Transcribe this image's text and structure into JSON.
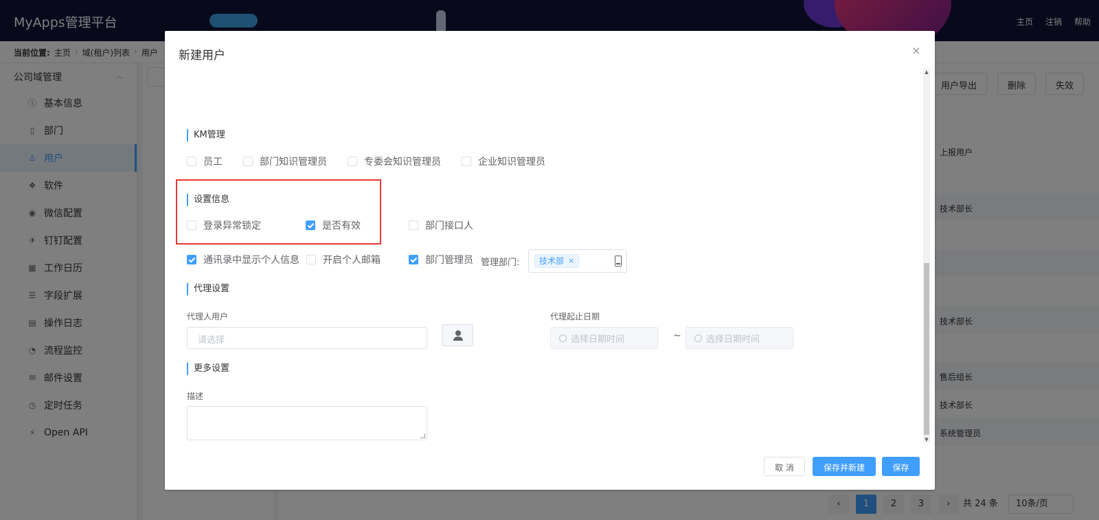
{
  "app": {
    "title": "MyApps管理平台"
  },
  "header": {
    "nav": [
      "主页",
      "注销",
      "帮助"
    ]
  },
  "breadcrumb": {
    "label": "当前位置:",
    "items": [
      "主页",
      "域(租户)列表",
      "用户"
    ]
  },
  "sidebar": {
    "group": "公司域管理",
    "items": [
      {
        "label": "基本信息",
        "icon": "info-icon"
      },
      {
        "label": "部门",
        "icon": "building-icon"
      },
      {
        "label": "用户",
        "icon": "user-icon",
        "active": true
      },
      {
        "label": "软件",
        "icon": "cubes-icon"
      },
      {
        "label": "微信配置",
        "icon": "wechat-icon"
      },
      {
        "label": "钉钉配置",
        "icon": "plane-icon"
      },
      {
        "label": "工作日历",
        "icon": "calendar-icon"
      },
      {
        "label": "字段扩展",
        "icon": "sliders-icon"
      },
      {
        "label": "操作日志",
        "icon": "log-icon"
      },
      {
        "label": "流程监控",
        "icon": "dashboard-icon"
      },
      {
        "label": "邮件设置",
        "icon": "mail-icon"
      },
      {
        "label": "定时任务",
        "icon": "clock-icon"
      },
      {
        "label": "Open API",
        "icon": "plug-icon"
      }
    ]
  },
  "background": {
    "buttons": [
      "用户导出",
      "删除",
      "失效"
    ],
    "column_header": "上报用户",
    "cells": [
      "技术部长",
      "技术部长",
      "售后组长",
      "技术部长",
      "系统管理员"
    ],
    "pager": {
      "pages": [
        "1",
        "2",
        "3"
      ],
      "total": "共 24 条",
      "page_size": "10条/页"
    }
  },
  "dialog": {
    "title": "新建用户",
    "km": {
      "title": "KM管理",
      "options": [
        "员工",
        "部门知识管理员",
        "专委会知识管理员",
        "企业知识管理员"
      ]
    },
    "settings": {
      "title": "设置信息",
      "lock_label": "登录异常锁定",
      "valid_label": "是否有效",
      "dept_contact_label": "部门接口人",
      "show_info_label": "通讯录中显示个人信息",
      "email_label": "开启个人邮箱",
      "dept_admin_label": "部门管理员",
      "manage_dept_label": "管理部门:",
      "manage_dept_tag": "技术部",
      "tag_close": "×"
    },
    "proxy": {
      "title": "代理设置",
      "user_label": "代理人用户",
      "user_placeholder": "请选择",
      "date_label": "代理起止日期",
      "start_placeholder": "选择日期时间",
      "end_placeholder": "选择日期时间",
      "separator": "~"
    },
    "more": {
      "title": "更多设置",
      "desc_label": "描述"
    },
    "footer": {
      "cancel": "取 消",
      "save_new": "保存并新建",
      "save": "保存"
    },
    "close_glyph": "×"
  },
  "colors": {
    "primary": "#409eff",
    "highlight": "#e53935",
    "header_bg": "#101538"
  }
}
